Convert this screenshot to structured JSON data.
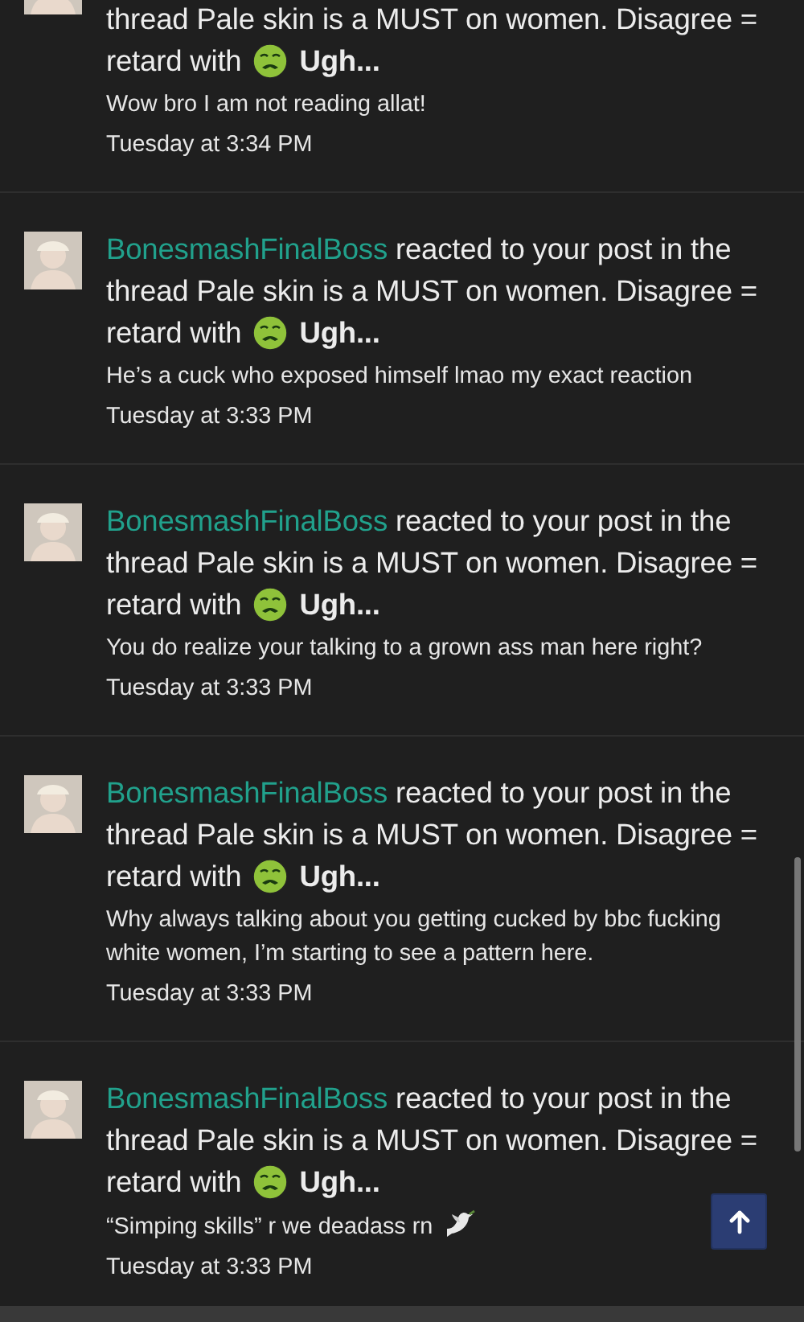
{
  "notifications": [
    {
      "kind": "partial",
      "text": "thread Pale skin is a MUST on women. Disagree = retard with",
      "reaction": "Ugh...",
      "message": "Wow bro I am not reading allat!",
      "emoji": false,
      "time": "Tuesday at 3:34 PM"
    },
    {
      "kind": "full",
      "user": "BonesmashFinalBoss",
      "text": "reacted to your post in the thread Pale skin is a MUST on women. Disagree = retard with",
      "reaction": "Ugh...",
      "message": "He’s a cuck who exposed himself lmao my exact reaction",
      "emoji": false,
      "time": "Tuesday at 3:33 PM"
    },
    {
      "kind": "full",
      "user": "BonesmashFinalBoss",
      "text": "reacted to your post in the thread Pale skin is a MUST on women. Disagree = retard with",
      "reaction": "Ugh...",
      "message": "You do realize your talking to a grown ass man here right?",
      "emoji": false,
      "time": "Tuesday at 3:33 PM"
    },
    {
      "kind": "full",
      "user": "BonesmashFinalBoss",
      "text": "reacted to your post in the thread Pale skin is a MUST on women. Disagree = retard with",
      "reaction": "Ugh...",
      "message": "Why always talking about you getting cucked by bbc fucking white women, I’m starting to see a pattern here.",
      "emoji": false,
      "time": "Tuesday at 3:33 PM"
    },
    {
      "kind": "full",
      "user": "BonesmashFinalBoss",
      "text": "reacted to your post in the thread Pale skin is a MUST on women. Disagree = retard with",
      "reaction": "Ugh...",
      "message": "“Simping skills” r we deadass rn",
      "emoji": true,
      "time": "Tuesday at 3:33 PM"
    }
  ]
}
